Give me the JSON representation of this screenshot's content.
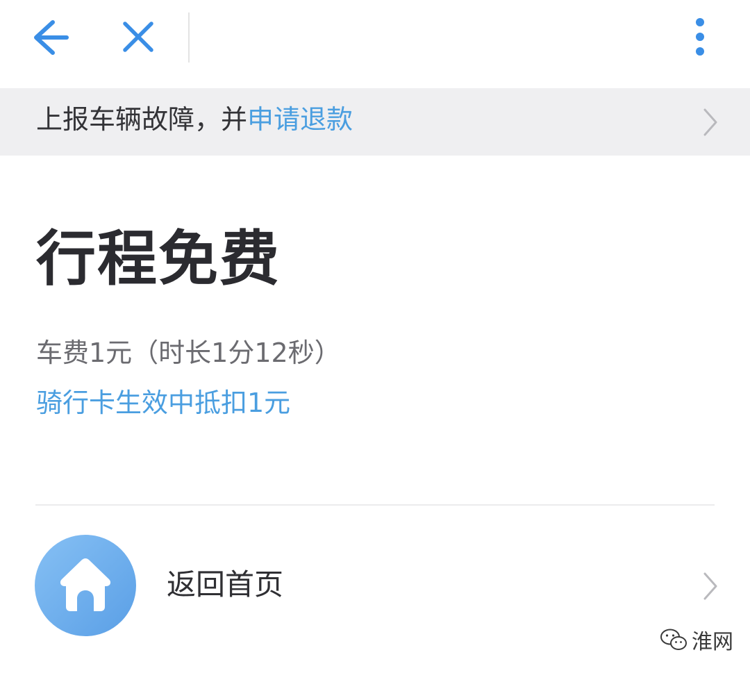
{
  "topbar": {
    "back_icon": "arrow-left-icon",
    "close_icon": "close-icon",
    "more_icon": "more-vertical-icon",
    "accent": "#3a8ee6"
  },
  "banner": {
    "text_prefix": "上报车辆故障，并",
    "link_text": "申请退款",
    "chevron_icon": "chevron-right-icon"
  },
  "trip": {
    "title": "行程免费",
    "fare_text": "车费1元（时长1分12秒）",
    "card_text": "骑行卡生效中抵扣1元"
  },
  "home_row": {
    "label": "返回首页",
    "icon": "home-icon",
    "chevron_icon": "chevron-right-icon"
  },
  "watermark": {
    "text": "淮网",
    "icon": "wechat-icon"
  },
  "colors": {
    "link_blue": "#4a9ee0",
    "title_dark": "#2b2b30",
    "banner_bg": "#efeff1"
  }
}
